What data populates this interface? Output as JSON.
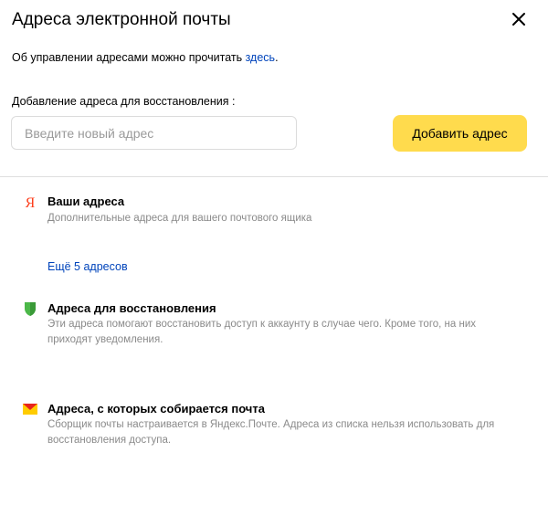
{
  "dialog": {
    "title": "Адреса электронной почты",
    "close_icon": "close-icon"
  },
  "info": {
    "text": "Об управлении адресами можно прочитать ",
    "link": "здесь",
    "suffix": "."
  },
  "add_address": {
    "label": "Добавление адреса для восстановления :",
    "placeholder": "Введите новый адрес",
    "value": "",
    "button_label": "Добавить адрес"
  },
  "sections": [
    {
      "icon": "yandex-logo-icon",
      "title": "Ваши адреса",
      "description": "Дополнительные адреса для вашего почтового ящика",
      "more_link": "Ещё 5 адресов"
    },
    {
      "icon": "shield-icon",
      "title": "Адреса для восстановления",
      "description": "Эти адреса помогают восстановить доступ к аккаунту в случае чего. Кроме того, на них приходят уведомления."
    },
    {
      "icon": "mail-envelope-icon",
      "title": "Адреса, с которых собирается почта",
      "description": "Сборщик почты настраивается в Яндекс.Почте. Адреса из списка нельзя использовать для восстановления доступа."
    }
  ],
  "colors": {
    "accent_button": "#ffdb4d",
    "link": "#0044bb",
    "yandex_red": "#fc3f1d",
    "shield_green": "#4cb849",
    "mail_red": "#e8251c",
    "mail_yellow": "#ffcc00",
    "muted_text": "#8a8a8a"
  }
}
